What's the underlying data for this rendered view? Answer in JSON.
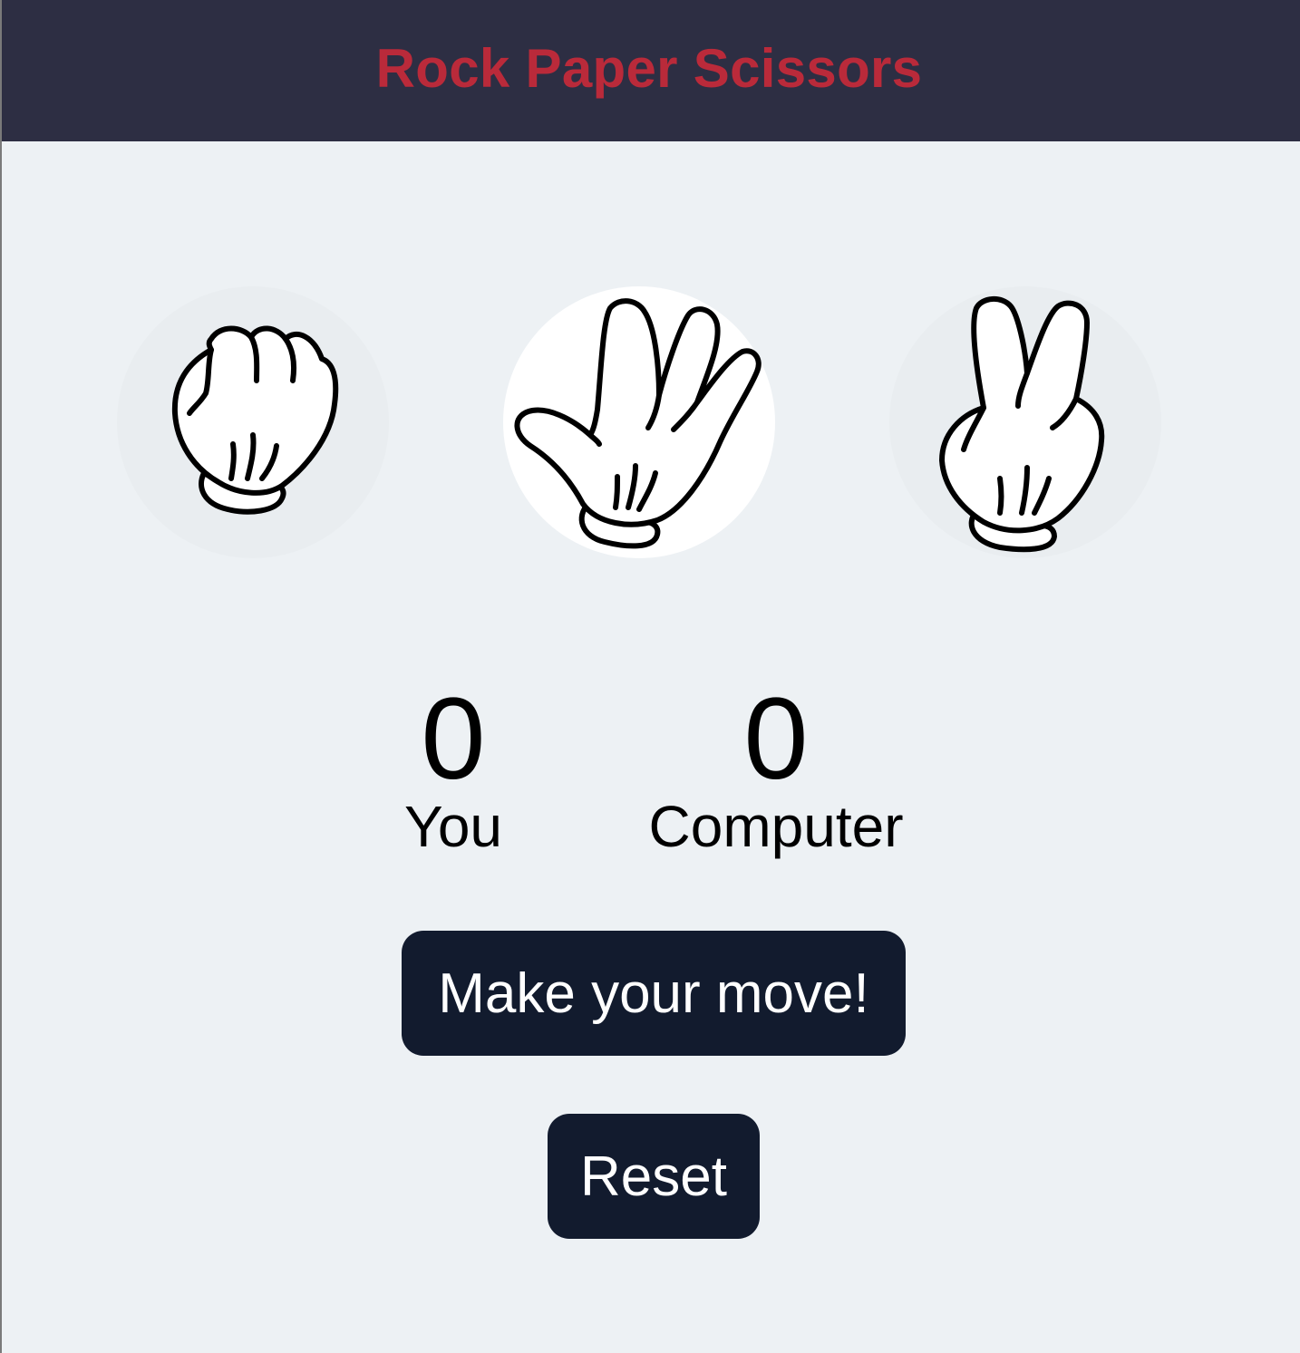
{
  "header": {
    "title": "Rock Paper Scissors"
  },
  "choices": [
    {
      "name": "rock",
      "icon": "rock-fist-glove-icon",
      "selected": false
    },
    {
      "name": "paper",
      "icon": "paper-open-hand-glove-icon",
      "selected": true
    },
    {
      "name": "scissors",
      "icon": "scissors-two-finger-glove-icon",
      "selected": false
    }
  ],
  "scoreboard": {
    "you": {
      "score": "0",
      "label": "You"
    },
    "computer": {
      "score": "0",
      "label": "Computer"
    }
  },
  "buttons": {
    "move_label": "Make your move!",
    "reset_label": "Reset"
  },
  "colors": {
    "header_bg": "#2d2e43",
    "title": "#ba2a3a",
    "page_bg": "#edf1f4",
    "button_bg": "#121b2e",
    "selected_circle": "#ffffff"
  }
}
